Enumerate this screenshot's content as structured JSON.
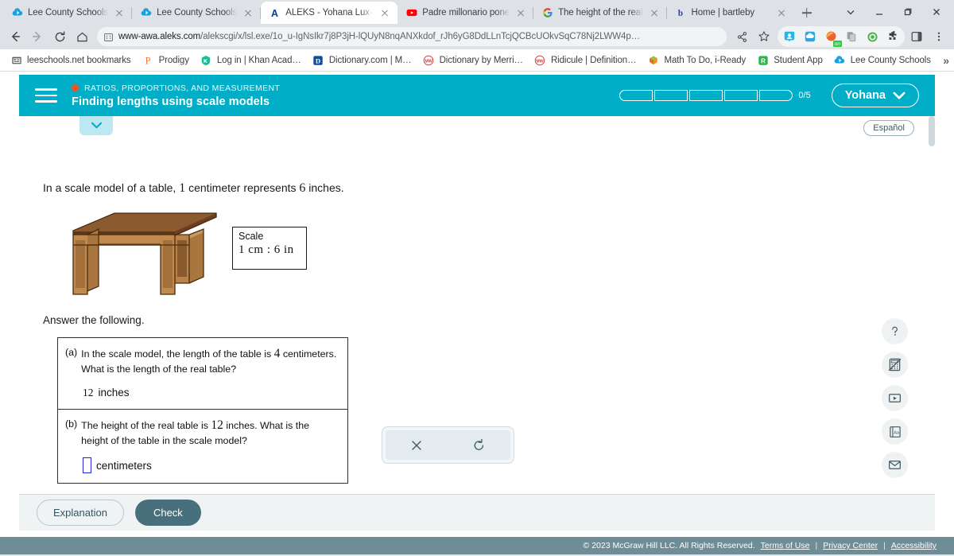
{
  "browser": {
    "tabs": [
      {
        "title": "Lee County Schools",
        "favicon": "cloud-icon",
        "active": false
      },
      {
        "title": "Lee County Schools",
        "favicon": "cloud-icon",
        "active": false
      },
      {
        "title": "ALEKS - Yohana Lux-M",
        "favicon": "aleks-a-icon",
        "active": true
      },
      {
        "title": "Padre millonario pone",
        "favicon": "youtube-icon",
        "active": false
      },
      {
        "title": "The height of the real",
        "favicon": "google-g-icon",
        "active": false
      },
      {
        "title": "Home | bartleby",
        "favicon": "bartleby-b-icon",
        "active": false
      }
    ],
    "new_tab_label": "+",
    "window_controls": [
      "chevron-down",
      "minimize",
      "maximize",
      "close"
    ],
    "nav": {
      "back": "back-arrow-icon",
      "forward": "forward-arrow-icon",
      "reload": "reload-icon",
      "home": "home-icon"
    },
    "omnibox": {
      "site_icon": "site-info-icon",
      "url_strong": "www-awa.aleks.com",
      "url_dim": "/alekscgi/x/lsl.exe/1o_u-IgNsIkr7j8P3jH-lQUyN8nqANXkdof_rJh6yG8DdLLnTcjQCBcUOkvSqC78Nj2LWW4p…",
      "share_icon": "share-icon",
      "bookmark_icon": "star-icon"
    },
    "extensions": [
      "person-badge-icon",
      "cloud-blue-icon",
      "grammarly-icon",
      "duplicate-tabs-icon",
      "green-shield-icon",
      "puzzle-icon"
    ],
    "side_panel_icon": "side-panel-icon",
    "menu_icon": "three-dot-menu-icon",
    "bookmarks": [
      {
        "label": "leeschools.net bookmarks",
        "icon": "folder-icon"
      },
      {
        "label": "Prodigy",
        "icon": "prodigy-icon"
      },
      {
        "label": "Log in | Khan Acad…",
        "icon": "khan-icon"
      },
      {
        "label": "Dictionary.com | M…",
        "icon": "dictionary-icon"
      },
      {
        "label": "Dictionary by Merri…",
        "icon": "merriam-webster-icon"
      },
      {
        "label": "Ridicule | Definition…",
        "icon": "merriam-webster-icon"
      },
      {
        "label": "Math To Do, i-Ready",
        "icon": "iready-icon"
      },
      {
        "label": "Student App",
        "icon": "roblox-icon"
      },
      {
        "label": "Lee County Schools",
        "icon": "cloud-icon"
      }
    ],
    "bookmarks_overflow": "»"
  },
  "aleks": {
    "header": {
      "menu_icon": "hamburger-menu-icon",
      "category": "RATIOS, PROPORTIONS, AND MEASUREMENT",
      "category_dot_color": "#f4511e",
      "topic": "Finding lengths using scale models",
      "progress_label": "0/5",
      "progress_segments": 5,
      "progress_filled": 0,
      "user_name": "Yohana",
      "user_chevron": "chevron-down-icon",
      "accent_color": "#00aec7"
    },
    "collapse_icon": "chevron-down-icon",
    "language_button": "Español",
    "question": {
      "intro_pre": "In a scale model of a table, ",
      "intro_num1": "1",
      "intro_mid": " centimeter represents ",
      "intro_num2": "6",
      "intro_post": " inches.",
      "figure_name": "table-illustration",
      "scale_box": {
        "title": "Scale",
        "ratio": "1 cm  :  6 in"
      },
      "answer_lead": "Answer the following.",
      "parts": [
        {
          "label": "(a)",
          "text_pre": "In the scale model, the length of the table is ",
          "text_num": "4",
          "text_post": " centimeters. What is the length of the real table?",
          "answer_value": "12",
          "answer_unit": "inches",
          "has_input": false
        },
        {
          "label": "(b)",
          "text_pre": "The height of the real table is ",
          "text_num": "12",
          "text_post": " inches. What is the height of the table in the scale model?",
          "answer_value": "",
          "answer_unit": "centimeters",
          "has_input": true
        }
      ]
    },
    "mini_toolbar": {
      "clear_icon": "x-clear-icon",
      "undo_icon": "undo-icon"
    },
    "side_tools": [
      {
        "icon": "help-question-icon",
        "name": "help"
      },
      {
        "icon": "calculator-disabled-icon",
        "name": "calculator-disabled"
      },
      {
        "icon": "video-play-icon",
        "name": "video"
      },
      {
        "icon": "dictionary-aa-icon",
        "name": "dictionary"
      },
      {
        "icon": "envelope-icon",
        "name": "message"
      }
    ],
    "footer": {
      "explanation_label": "Explanation",
      "check_label": "Check"
    },
    "copyright": {
      "text": "© 2023 McGraw Hill LLC. All Rights Reserved.",
      "links": [
        "Terms of Use",
        "Privacy Center",
        "Accessibility"
      ],
      "divider": "|"
    }
  }
}
